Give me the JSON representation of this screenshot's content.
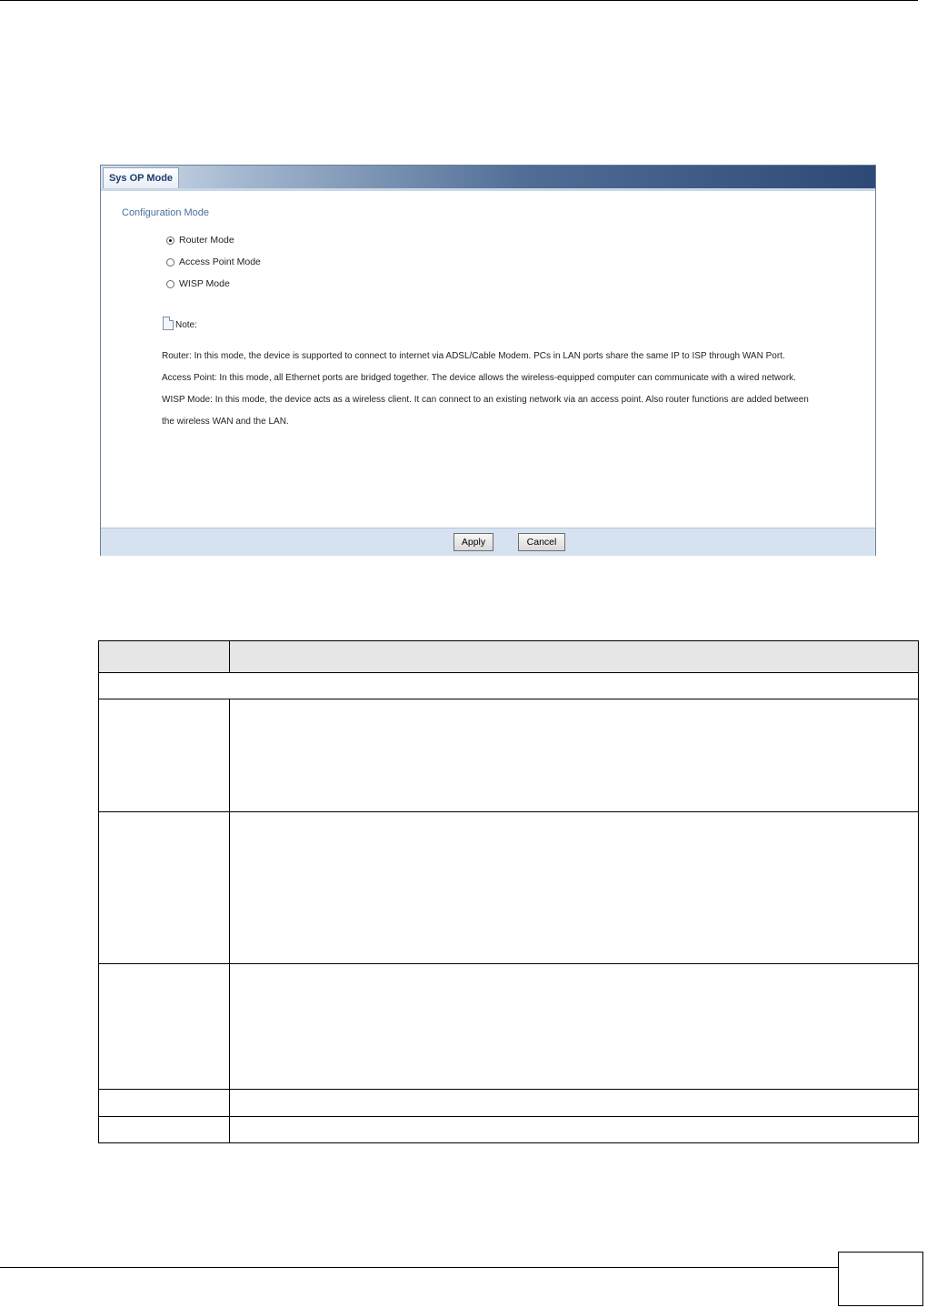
{
  "panel": {
    "tab_label": "Sys OP Mode",
    "section_title": "Configuration Mode",
    "modes": [
      {
        "label": "Router Mode",
        "checked": true
      },
      {
        "label": "Access Point Mode",
        "checked": false
      },
      {
        "label": "WISP Mode",
        "checked": false
      }
    ],
    "note_label": "Note:",
    "descriptions": [
      "Router: In this mode, the device is supported to connect to internet via ADSL/Cable Modem. PCs in LAN ports share the same IP to ISP through WAN Port.",
      "Access Point: In this mode, all Ethernet ports are bridged together. The device allows the wireless-equipped computer can communicate with a wired network.",
      "WISP Mode: In this mode, the device acts as a wireless client. It can connect to an existing network via an access point. Also router functions are added between",
      "the wireless WAN and the LAN."
    ],
    "apply_label": "Apply",
    "cancel_label": "Cancel"
  },
  "colors": {
    "header_dark": "#2c4a75",
    "section_title": "#4a6f9e",
    "footer": "#d6e2f0"
  }
}
